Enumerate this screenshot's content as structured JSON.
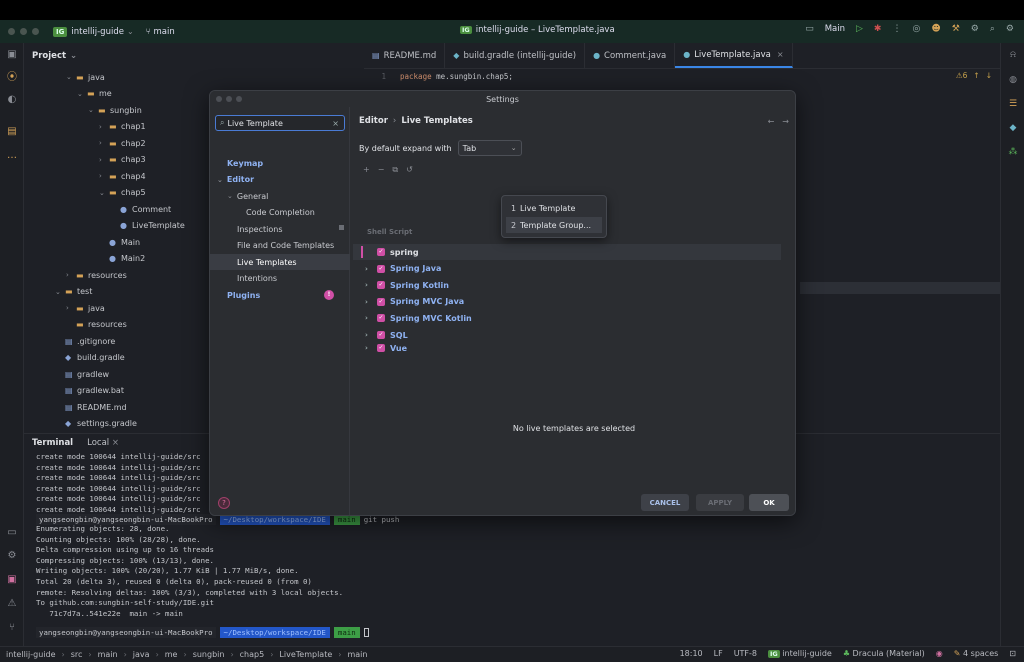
{
  "titlebar": {
    "project_badge": "IG",
    "project_name": "intellij-guide",
    "branch": "main",
    "window_title": "intellij-guide – LiveTemplate.java",
    "run_config": "Main"
  },
  "project_panel": {
    "title": "Project",
    "tree": [
      {
        "label": "java",
        "indent": 2,
        "icon": "folder",
        "expand": "open"
      },
      {
        "label": "me",
        "indent": 3,
        "icon": "folder",
        "expand": "open"
      },
      {
        "label": "sungbin",
        "indent": 4,
        "icon": "folder",
        "expand": "open"
      },
      {
        "label": "chap1",
        "indent": 5,
        "icon": "folder",
        "expand": "closed"
      },
      {
        "label": "chap2",
        "indent": 5,
        "icon": "folder",
        "expand": "closed"
      },
      {
        "label": "chap3",
        "indent": 5,
        "icon": "folder",
        "expand": "closed"
      },
      {
        "label": "chap4",
        "indent": 5,
        "icon": "folder",
        "expand": "closed"
      },
      {
        "label": "chap5",
        "indent": 5,
        "icon": "folder",
        "expand": "open"
      },
      {
        "label": "Comment",
        "indent": 6,
        "icon": "class"
      },
      {
        "label": "LiveTemplate",
        "indent": 6,
        "icon": "class"
      },
      {
        "label": "Main",
        "indent": 5,
        "icon": "class"
      },
      {
        "label": "Main2",
        "indent": 5,
        "icon": "class"
      },
      {
        "label": "resources",
        "indent": 2,
        "icon": "folder",
        "expand": "closed"
      },
      {
        "label": "test",
        "indent": 1,
        "icon": "folder",
        "expand": "open"
      },
      {
        "label": "java",
        "indent": 2,
        "icon": "folder",
        "expand": "closed"
      },
      {
        "label": "resources",
        "indent": 2,
        "icon": "folder"
      },
      {
        "label": ".gitignore",
        "indent": 1,
        "icon": "file"
      },
      {
        "label": "build.gradle",
        "indent": 1,
        "icon": "gradle"
      },
      {
        "label": "gradlew",
        "indent": 1,
        "icon": "file"
      },
      {
        "label": "gradlew.bat",
        "indent": 1,
        "icon": "file"
      },
      {
        "label": "README.md",
        "indent": 1,
        "icon": "file"
      },
      {
        "label": "settings.gradle",
        "indent": 1,
        "icon": "gradle"
      }
    ]
  },
  "editor": {
    "tabs": [
      {
        "label": "README.md",
        "icon": "▤"
      },
      {
        "label": "build.gradle (intellij-guide)",
        "icon": "◆"
      },
      {
        "label": "Comment.java",
        "icon": "●"
      },
      {
        "label": "LiveTemplate.java",
        "icon": "●",
        "active": true
      }
    ],
    "line_no": "1",
    "code_keyword": "package",
    "code_rest": " me.sungbin.chap5;",
    "warning": "⚠6"
  },
  "terminal": {
    "tab_terminal": "Terminal",
    "tab_local": "Local",
    "output": "create mode 100644 intellij-guide/src\ncreate mode 100644 intellij-guide/src\ncreate mode 100644 intellij-guide/src\ncreate mode 100644 intellij-guide/src\ncreate mode 100644 intellij-guide/src\ncreate mode 100644 intellij-guide/src",
    "prev_user": "yangseongbin@yangseongbin-ui-MacBookPro",
    "prev_cmd": "git push",
    "output2": "Enumerating objects: 28, done.\nCounting objects: 100% (28/28), done.\nDelta compression using up to 16 threads\nCompressing objects: 100% (13/13), done.\nWriting objects: 100% (20/20), 1.77 KiB | 1.77 MiB/s, done.\nTotal 20 (delta 3), reused 0 (delta 0), pack-reused 0 (from 0)\nremote: Resolving deltas: 100% (3/3), completed with 3 local objects.\nTo github.com:sungbin-self-study/IDE.git\n   71c7d7a..541e22e  main -> main",
    "prompt_user": "yangseongbin@yangseongbin-ui-MacBookPro",
    "prompt_path": "~/Desktop/workspace/IDE",
    "prompt_branch": "main"
  },
  "statusbar": {
    "breadcrumbs": [
      "intellij-guide",
      "src",
      "main",
      "java",
      "me",
      "sungbin",
      "chap5",
      "LiveTemplate",
      "main"
    ],
    "position": "18:10",
    "line_sep": "LF",
    "encoding": "UTF-8",
    "project_badge": "IG",
    "project": "intellij-guide",
    "theme": "Dracula (Material)",
    "indent": "4 spaces"
  },
  "settings_dialog": {
    "title": "Settings",
    "search_value": "Live Template",
    "nav": [
      {
        "label": "Keymap",
        "level": 0,
        "bold": true
      },
      {
        "label": "Editor",
        "level": 0,
        "bold": true,
        "caret": "open"
      },
      {
        "label": "General",
        "level": 1,
        "caret": "open"
      },
      {
        "label": "Code Completion",
        "level": 2
      },
      {
        "label": "Inspections",
        "level": 1,
        "badge": true
      },
      {
        "label": "File and Code Templates",
        "level": 1
      },
      {
        "label": "Live Templates",
        "level": 1,
        "selected": true
      },
      {
        "label": "Intentions",
        "level": 1
      },
      {
        "label": "Plugins",
        "level": 0,
        "bold": true,
        "pill": true
      }
    ],
    "breadcrumb_editor": "Editor",
    "breadcrumb_page": "Live Templates",
    "expand_label": "By default expand with",
    "expand_value": "Tab",
    "popup": [
      {
        "num": "1",
        "label": "Live Template"
      },
      {
        "num": "2",
        "label": "Template Group...",
        "hover": true
      }
    ],
    "templates": [
      {
        "label": "spring",
        "selected": true,
        "caret": false
      },
      {
        "label": "Spring Java",
        "caret": true
      },
      {
        "label": "Spring Kotlin",
        "caret": true
      },
      {
        "label": "Spring MVC Java",
        "caret": true
      },
      {
        "label": "Spring MVC Kotlin",
        "caret": true
      },
      {
        "label": "SQL",
        "caret": true
      },
      {
        "label": "Vue",
        "caret": true
      }
    ],
    "hidden_row_fragment": "Shell Script",
    "empty_message": "No live templates are selected",
    "cancel_label": "CANCEL",
    "apply_label": "APPLY",
    "ok_label": "OK"
  }
}
